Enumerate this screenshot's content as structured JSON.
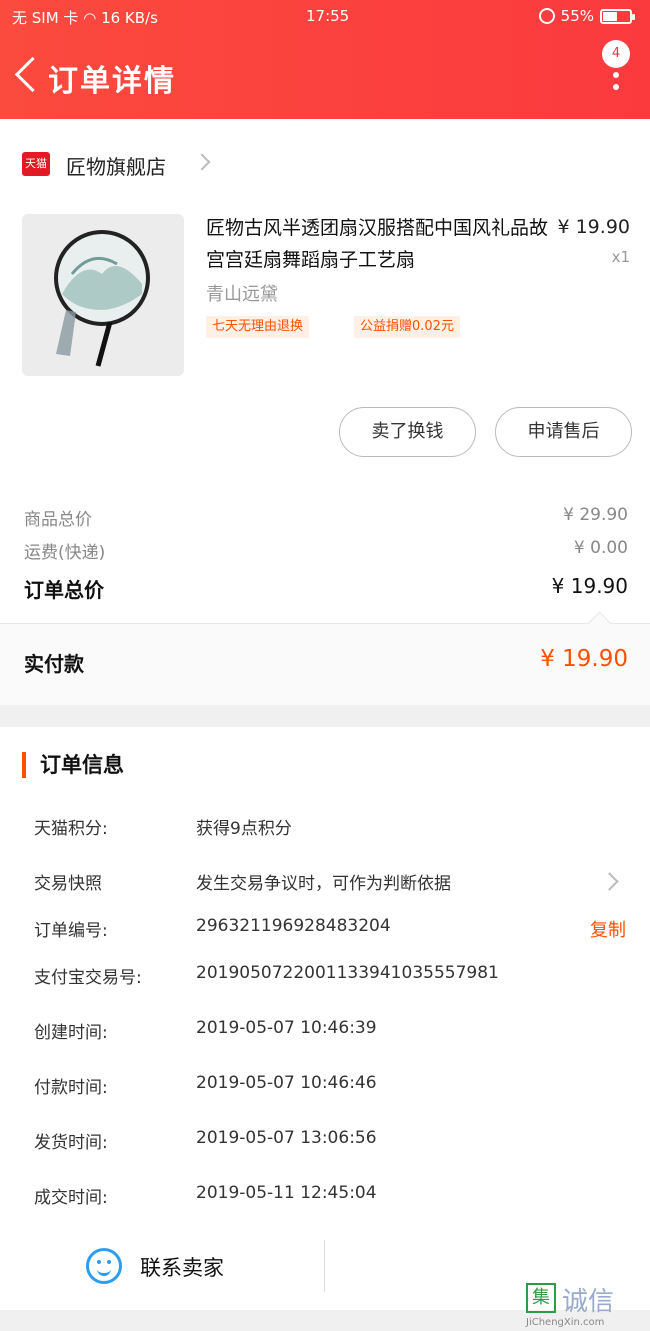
{
  "status_bar": {
    "carrier": "无 SIM 卡",
    "speed": "16 KB/s",
    "time": "17:55",
    "battery_text": "55%",
    "battery_level": 0.55
  },
  "header": {
    "title": "订单详情",
    "badge_count": "4"
  },
  "shop": {
    "logo_text": "天猫",
    "name": "匠物旗舰店"
  },
  "product": {
    "title": "匠物古风半透团扇汉服搭配中国风礼品故宫宫廷扇舞蹈扇子工艺扇",
    "price": "¥ 19.90",
    "qty": "x1",
    "sku": "青山远黛",
    "tags": [
      "七天无理由退换",
      "公益捐赠0.02元"
    ]
  },
  "actions": {
    "exchange": "卖了换钱",
    "after_sale": "申请售后"
  },
  "costs": {
    "goods_label": "商品总价",
    "goods_value": "¥ 29.90",
    "shipping_label": "运费(快递)",
    "shipping_value": "¥ 0.00",
    "total_label": "订单总价",
    "total_value": "¥ 19.90"
  },
  "paid": {
    "label": "实付款",
    "value": "¥ 19.90"
  },
  "order_info": {
    "title": "订单信息",
    "rows": [
      {
        "label": "天猫积分:",
        "value": "获得9点积分"
      },
      {
        "label": "交易快照",
        "value": "发生交易争议时，可作为判断依据"
      },
      {
        "label": "订单编号:",
        "value": "296321196928483204",
        "action": "复制"
      },
      {
        "label": "支付宝交易号:",
        "value": "2019050722001133941035557981"
      },
      {
        "label": "创建时间:",
        "value": "2019-05-07 10:46:39"
      },
      {
        "label": "付款时间:",
        "value": "2019-05-07 10:46:46"
      },
      {
        "label": "发货时间:",
        "value": "2019-05-07 13:06:56"
      },
      {
        "label": "成交时间:",
        "value": "2019-05-11 12:45:04"
      }
    ]
  },
  "bottom": {
    "contact_label": "联系卖家"
  },
  "watermark": {
    "mark": "集",
    "cn": "诚信",
    "en": "JiChengXin.com"
  },
  "colors": {
    "header_bg": "#fb3a3e",
    "accent": "#ff5000",
    "contact_icon": "#2d9df0"
  }
}
